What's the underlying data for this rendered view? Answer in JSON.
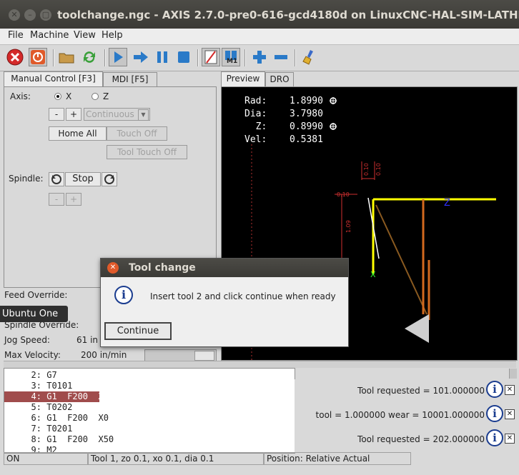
{
  "window": {
    "title": "toolchange.ngc - AXIS 2.7.0-pre0-616-gcd4180d on LinuxCNC-HAL-SIM-LATHE"
  },
  "menu": [
    "File",
    "Machine",
    "View",
    "Help"
  ],
  "toolbar": {
    "icons": [
      "estop-icon",
      "power-icon",
      "open-icon",
      "reload-icon",
      "run-icon",
      "step-icon",
      "pause-icon",
      "stop-icon",
      "block-delete-icon",
      "optional-stop-icon",
      "zoom-in-icon",
      "zoom-out-icon",
      "clear-plot-icon"
    ],
    "m1_label": "M1"
  },
  "left_tabs": [
    "Manual Control [F3]",
    "MDI [F5]"
  ],
  "manual": {
    "axis_label": "Axis:",
    "axis_x": "X",
    "axis_z": "Z",
    "minus": "-",
    "plus": "+",
    "jog_mode": "Continuous",
    "home_all": "Home All",
    "touch_off": "Touch Off",
    "tool_touch_off": "Tool Touch Off",
    "spindle_label": "Spindle:",
    "stop": "Stop"
  },
  "overrides": {
    "feed_override": "Feed Override:",
    "spindle_override": "Spindle Override:",
    "jog_speed_label": "Jog Speed:",
    "jog_speed_value": "61 in",
    "max_velocity_label": "Max Velocity:",
    "max_velocity_value": "200 in/min"
  },
  "right_tabs": [
    "Preview",
    "DRO"
  ],
  "dro": [
    {
      "label": "Rad:",
      "value": "1.8990"
    },
    {
      "label": "Dia:",
      "value": "3.7980"
    },
    {
      "label": "  Z:",
      "value": "0.8990"
    },
    {
      "label": "Vel:",
      "value": "0.5381"
    }
  ],
  "preview_dims": {
    "top_a": "0.10",
    "top_b": "0.10",
    "left": "0.10",
    "vertical": "1.09",
    "axis_z": "Z",
    "axis_x": "X"
  },
  "gcode": [
    {
      "num": "2:",
      "code": "G7"
    },
    {
      "num": "3:",
      "code": "T0101"
    },
    {
      "num": "4:",
      "code": "G1  F200  X50"
    },
    {
      "num": "5:",
      "code": "T0202"
    },
    {
      "num": "6:",
      "code": "G1  F200  X0"
    },
    {
      "num": "7:",
      "code": "T0201"
    },
    {
      "num": "8:",
      "code": "G1  F200  X50"
    },
    {
      "num": "9:",
      "code": "M2"
    }
  ],
  "notifications": [
    {
      "text": "Tool requested = 101.000000"
    },
    {
      "text": "tool = 1.000000 wear = 10001.000000"
    },
    {
      "text": "Tool requested = 202.000000"
    }
  ],
  "status": {
    "state": "ON",
    "tool": "Tool 1, zo 0.1, xo 0.1, dia 0.1",
    "position": "Position: Relative Actual"
  },
  "dialog": {
    "title": "Tool change",
    "message": "Insert tool 2 and click continue when ready",
    "button": "Continue"
  },
  "tooltip": "Ubuntu One",
  "colors": {
    "highlight_row": "#a04c4c",
    "tool_path": "#ffff00",
    "rapid_path": "#d2691e"
  }
}
